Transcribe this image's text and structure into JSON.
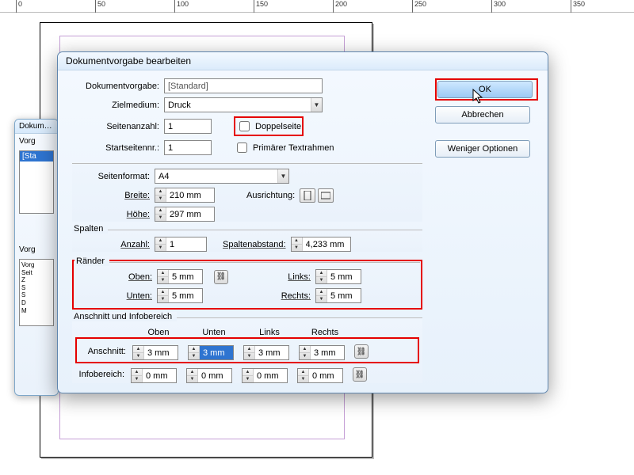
{
  "ruler": {
    "ticks": [
      "0",
      "50",
      "100",
      "150",
      "200",
      "250",
      "300",
      "350"
    ]
  },
  "back_dialog": {
    "title": "Dokum…",
    "list_label": "Vorg",
    "list_selected": "[Sta",
    "preview_label": "Vorg",
    "preview_lines": [
      "Vorg",
      "Seit",
      "Z",
      "S",
      "S",
      "D",
      "M"
    ]
  },
  "dialog": {
    "title": "Dokumentvorgabe bearbeiten",
    "preset_label": "Dokumentvorgabe:",
    "preset_value": "[Standard]",
    "intent_label": "Zielmedium:",
    "intent_value": "Druck",
    "pages_label": "Seitenanzahl:",
    "pages_value": "1",
    "facing_label": "Doppelseite",
    "facing_checked": false,
    "startpage_label": "Startseitennr.:",
    "startpage_value": "1",
    "frame_label": "Primärer Textrahmen",
    "frame_checked": false,
    "format_label": "Seitenformat:",
    "format_value": "A4",
    "width_label": "Breite:",
    "width_value": "210 mm",
    "height_label": "Höhe:",
    "height_value": "297 mm",
    "orient_label": "Ausrichtung:",
    "columns": {
      "legend": "Spalten",
      "count_label": "Anzahl:",
      "count_value": "1",
      "gutter_label": "Spaltenabstand:",
      "gutter_value": "4,233 mm"
    },
    "margins": {
      "legend": "Ränder",
      "top_label": "Oben:",
      "top_value": "5 mm",
      "bottom_label": "Unten:",
      "bottom_value": "5 mm",
      "left_label": "Links:",
      "left_value": "5 mm",
      "right_label": "Rechts:",
      "right_value": "5 mm"
    },
    "bleed": {
      "legend": "Anschnitt und Infobereich",
      "col_top": "Oben",
      "col_bottom": "Unten",
      "col_left": "Links",
      "col_right": "Rechts",
      "bleed_label": "Anschnitt:",
      "bleed_top": "3 mm",
      "bleed_bottom": "3 mm",
      "bleed_left": "3 mm",
      "bleed_right": "3 mm",
      "slug_label": "Infobereich:",
      "slug_top": "0 mm",
      "slug_bottom": "0 mm",
      "slug_left": "0 mm",
      "slug_right": "0 mm"
    },
    "buttons": {
      "ok": "OK",
      "cancel": "Abbrechen",
      "fewer": "Weniger Optionen"
    }
  }
}
